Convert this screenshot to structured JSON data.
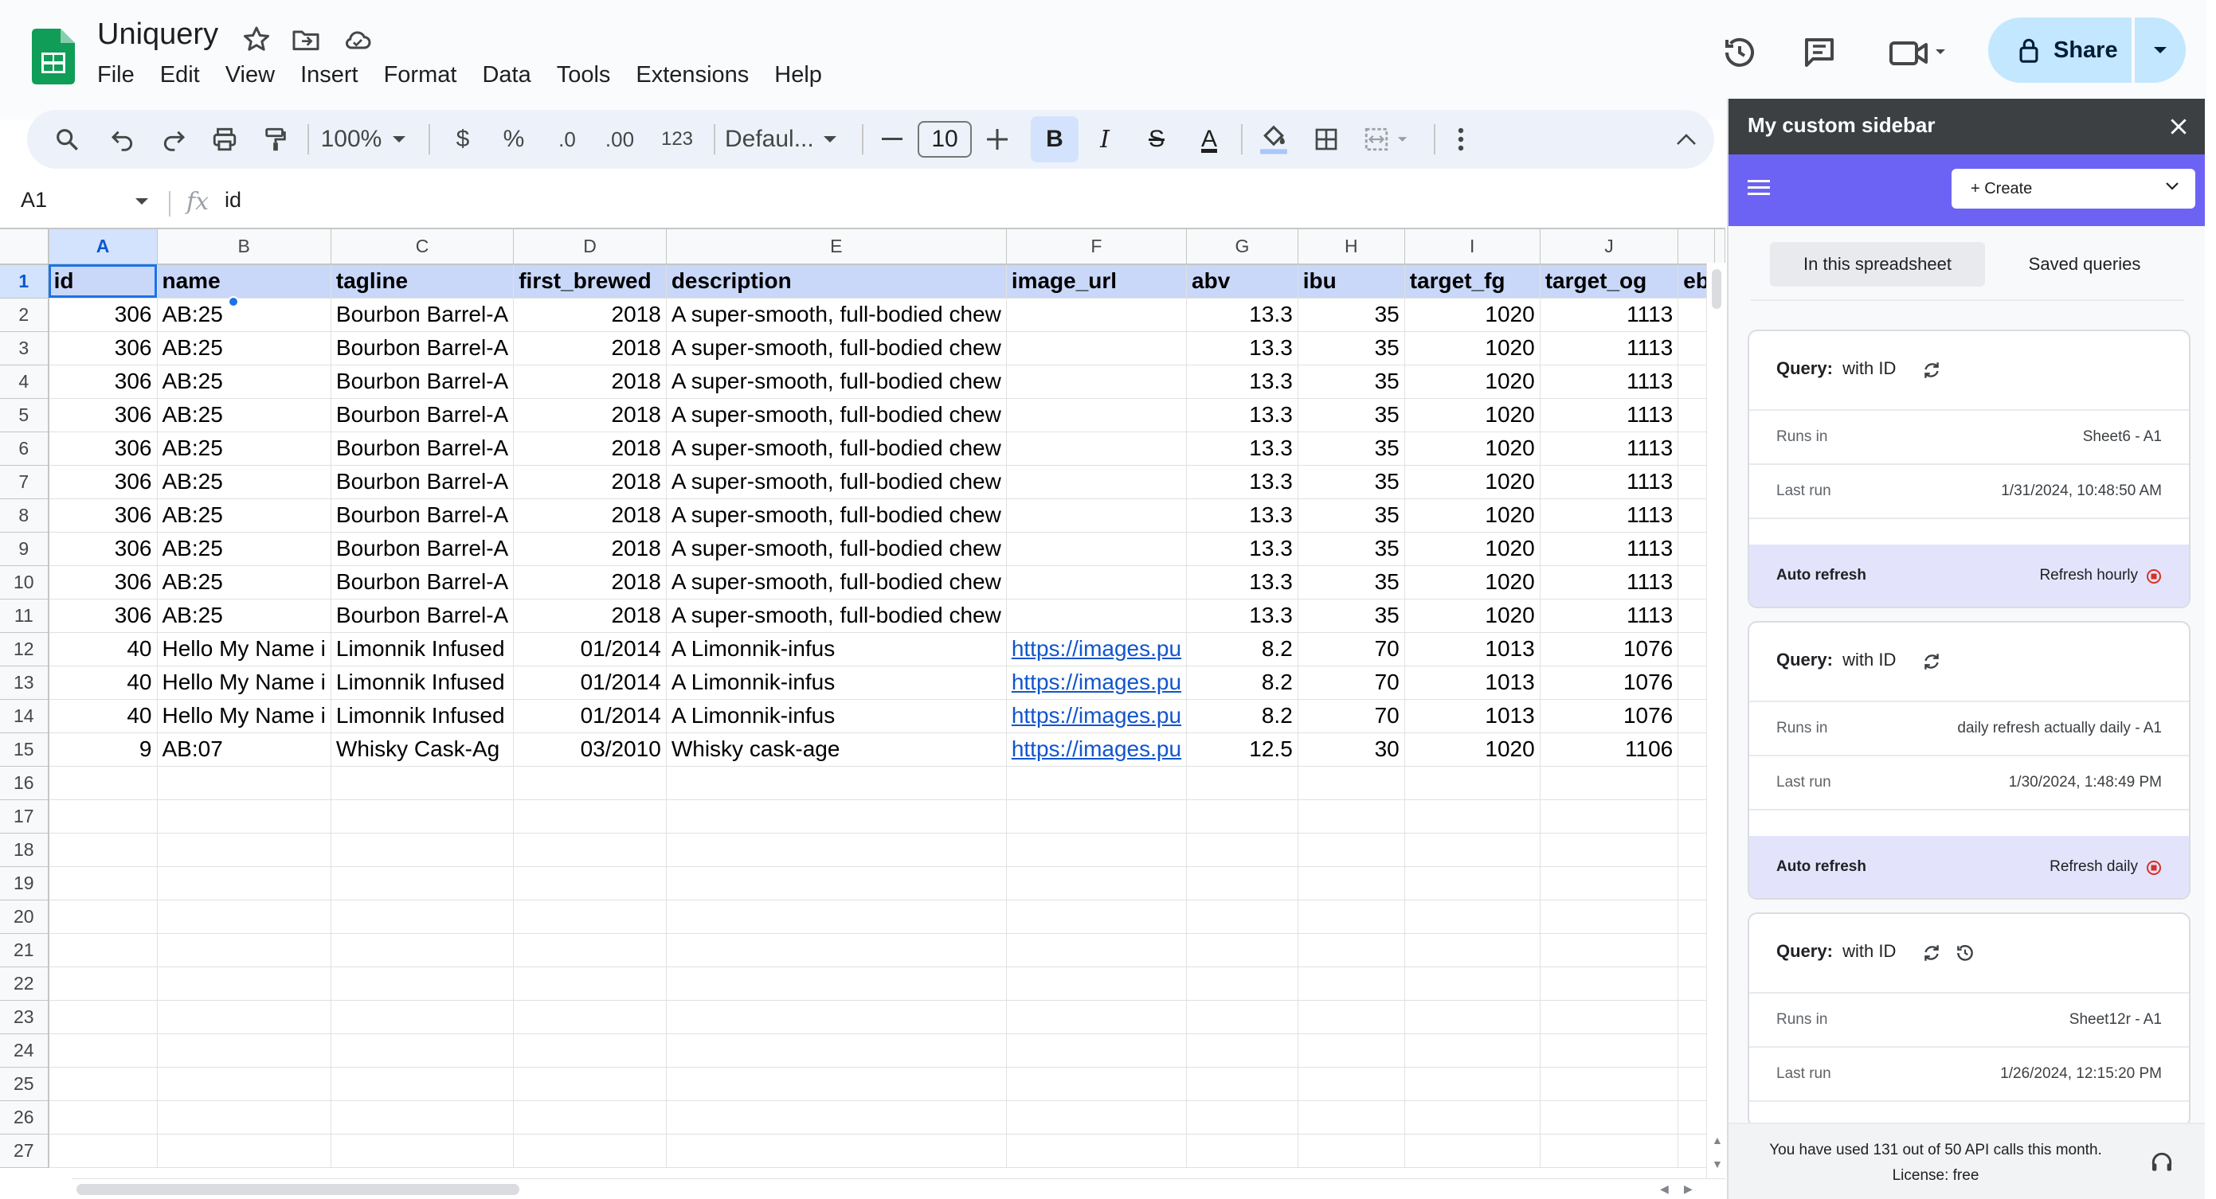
{
  "app": {
    "title": "Uniquery",
    "menus": [
      "File",
      "Edit",
      "View",
      "Insert",
      "Format",
      "Data",
      "Tools",
      "Extensions",
      "Help"
    ],
    "share_label": "Share"
  },
  "toolbar": {
    "zoom": "100%",
    "currency": "$",
    "percent": "%",
    "dec_decrease": ".0",
    "dec_increase": ".00",
    "number_format": "123",
    "font": "Defaul...",
    "font_size": "10",
    "bold": "B",
    "italic": "I",
    "strike": "S",
    "text_color": "A"
  },
  "formula_bar": {
    "cell_ref": "A1",
    "fx": "fx",
    "content": "id"
  },
  "grid": {
    "column_letters": [
      "A",
      "B",
      "C",
      "D",
      "E",
      "F",
      "G",
      "H",
      "I",
      "J",
      ""
    ],
    "header_row": [
      "id",
      "name",
      "tagline",
      "first_brewed",
      "description",
      "image_url",
      "abv",
      "ibu",
      "target_fg",
      "target_og",
      "eb"
    ],
    "rows": [
      [
        "306",
        "AB:25",
        "Bourbon Barrel-A",
        "2018",
        "A super-smooth, full-bodied chew",
        "",
        "13.3",
        "35",
        "1020",
        "1113",
        ""
      ],
      [
        "306",
        "AB:25",
        "Bourbon Barrel-A",
        "2018",
        "A super-smooth, full-bodied chew",
        "",
        "13.3",
        "35",
        "1020",
        "1113",
        ""
      ],
      [
        "306",
        "AB:25",
        "Bourbon Barrel-A",
        "2018",
        "A super-smooth, full-bodied chew",
        "",
        "13.3",
        "35",
        "1020",
        "1113",
        ""
      ],
      [
        "306",
        "AB:25",
        "Bourbon Barrel-A",
        "2018",
        "A super-smooth, full-bodied chew",
        "",
        "13.3",
        "35",
        "1020",
        "1113",
        ""
      ],
      [
        "306",
        "AB:25",
        "Bourbon Barrel-A",
        "2018",
        "A super-smooth, full-bodied chew",
        "",
        "13.3",
        "35",
        "1020",
        "1113",
        ""
      ],
      [
        "306",
        "AB:25",
        "Bourbon Barrel-A",
        "2018",
        "A super-smooth, full-bodied chew",
        "",
        "13.3",
        "35",
        "1020",
        "1113",
        ""
      ],
      [
        "306",
        "AB:25",
        "Bourbon Barrel-A",
        "2018",
        "A super-smooth, full-bodied chew",
        "",
        "13.3",
        "35",
        "1020",
        "1113",
        ""
      ],
      [
        "306",
        "AB:25",
        "Bourbon Barrel-A",
        "2018",
        "A super-smooth, full-bodied chew",
        "",
        "13.3",
        "35",
        "1020",
        "1113",
        ""
      ],
      [
        "306",
        "AB:25",
        "Bourbon Barrel-A",
        "2018",
        "A super-smooth, full-bodied chew",
        "",
        "13.3",
        "35",
        "1020",
        "1113",
        ""
      ],
      [
        "306",
        "AB:25",
        "Bourbon Barrel-A",
        "2018",
        "A super-smooth, full-bodied chew",
        "",
        "13.3",
        "35",
        "1020",
        "1113",
        ""
      ],
      [
        "40",
        "Hello My Name i",
        "Limonnik Infused",
        "01/2014",
        "A Limonnik-infus",
        "https://images.pu",
        "8.2",
        "70",
        "1013",
        "1076",
        ""
      ],
      [
        "40",
        "Hello My Name i",
        "Limonnik Infused",
        "01/2014",
        "A Limonnik-infus",
        "https://images.pu",
        "8.2",
        "70",
        "1013",
        "1076",
        ""
      ],
      [
        "40",
        "Hello My Name i",
        "Limonnik Infused",
        "01/2014",
        "A Limonnik-infus",
        "https://images.pu",
        "8.2",
        "70",
        "1013",
        "1076",
        ""
      ],
      [
        "9",
        "AB:07",
        "Whisky Cask-Ag",
        "03/2010",
        "Whisky cask-age",
        "https://images.pu",
        "12.5",
        "30",
        "1020",
        "1106",
        ""
      ]
    ],
    "numeric_columns": [
      0,
      3,
      6,
      7,
      8,
      9
    ],
    "link_column": 5,
    "total_rows": 27
  },
  "sidebar": {
    "title": "My custom sidebar",
    "create_label": "+ Create",
    "tabs": [
      "In this spreadsheet",
      "Saved queries"
    ],
    "queries": [
      {
        "label": "Query:",
        "name": "with ID",
        "runs_in_label": "Runs in",
        "runs_in": "Sheet6 - A1",
        "last_run_label": "Last run",
        "last_run": "1/31/2024, 10:48:50 AM",
        "auto_refresh_label": "Auto refresh",
        "auto_refresh": "Refresh hourly"
      },
      {
        "label": "Query:",
        "name": "with ID",
        "runs_in_label": "Runs in",
        "runs_in": "daily refresh actually daily - A1",
        "last_run_label": "Last run",
        "last_run": "1/30/2024, 1:48:49 PM",
        "auto_refresh_label": "Auto refresh",
        "auto_refresh": "Refresh daily"
      },
      {
        "label": "Query:",
        "name": "with ID",
        "runs_in_label": "Runs in",
        "runs_in": "Sheet12r - A1",
        "last_run_label": "Last run",
        "last_run": "1/26/2024, 12:15:20 PM"
      }
    ],
    "footer_line1": "You have used 131 out of 50 API calls this month.",
    "footer_line2": "License: free"
  },
  "colors": {
    "accent": "#1a73e8",
    "share_bg": "#c2e7ff",
    "sidebar_purple": "#6c63f5",
    "header_fill": "#c9d7f8",
    "link": "#1155cc"
  }
}
